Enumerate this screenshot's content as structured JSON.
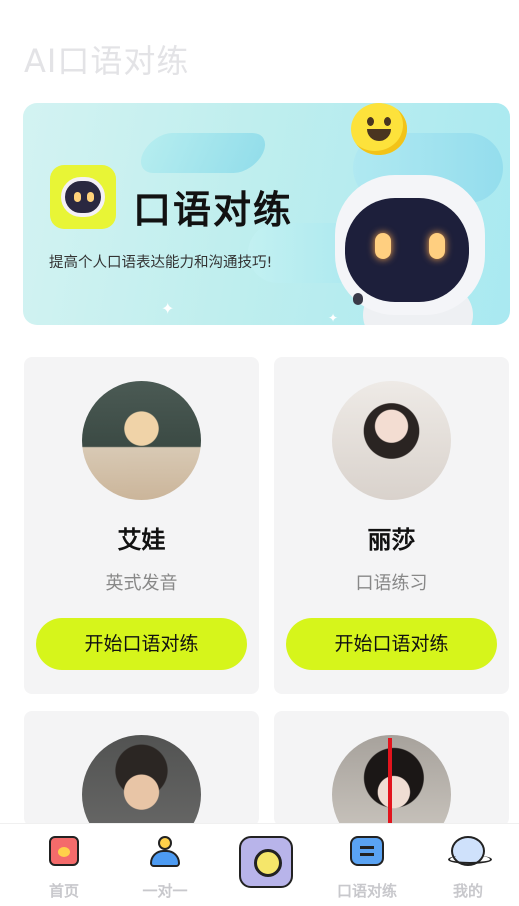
{
  "header": {
    "title": "AI口语对练"
  },
  "banner": {
    "title": "口语对练",
    "subtitle": "提高个人口语表达能力和沟通技巧!"
  },
  "tutors": [
    {
      "name": "艾娃",
      "desc": "英式发音",
      "button": "开始口语对练"
    },
    {
      "name": "丽莎",
      "desc": "口语练习",
      "button": "开始口语对练"
    },
    {
      "name": "",
      "desc": "",
      "button": ""
    },
    {
      "name": "",
      "desc": "",
      "button": ""
    }
  ],
  "nav": {
    "items": [
      {
        "label": "首页",
        "icon": "gift-box-icon"
      },
      {
        "label": "一对一",
        "icon": "user-icon"
      },
      {
        "label": "",
        "icon": "camera-icon"
      },
      {
        "label": "口语对练",
        "icon": "chat-bubble-icon"
      },
      {
        "label": "我的",
        "icon": "planet-icon"
      }
    ]
  },
  "colors": {
    "accent": "#d6f51b",
    "title_gray": "#e3e3e6",
    "annotation_arrow": "#e2141d"
  }
}
